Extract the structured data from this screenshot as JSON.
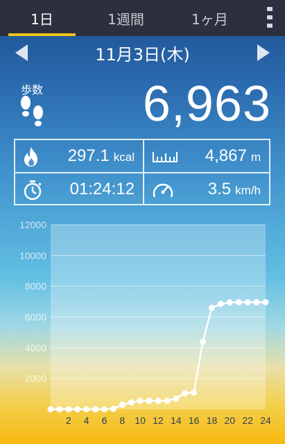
{
  "tabs": [
    {
      "label": "1日",
      "active": true
    },
    {
      "label": "1週間",
      "active": false
    },
    {
      "label": "1ヶ月",
      "active": false
    }
  ],
  "date": "11月3日(木)",
  "steps": {
    "label": "歩数",
    "value": "6,963"
  },
  "stats": {
    "calories": {
      "value": "297.1",
      "unit": "kcal",
      "icon": "flame-icon"
    },
    "distance": {
      "value": "4,867",
      "unit": "m",
      "icon": "ruler-icon"
    },
    "duration": {
      "value": "01:24:12",
      "icon": "stopwatch-icon"
    },
    "speed": {
      "value": "3.5",
      "unit": "km/h",
      "icon": "speedometer-icon"
    }
  },
  "chart_data": {
    "type": "line",
    "title": "",
    "xlabel": "",
    "ylabel": "",
    "ylim": [
      0,
      12000
    ],
    "yticks": [
      2000,
      4000,
      6000,
      8000,
      10000,
      12000
    ],
    "xticks": [
      2,
      4,
      6,
      8,
      10,
      12,
      14,
      16,
      18,
      20,
      22,
      24
    ],
    "grid": true,
    "series": [
      {
        "color": "#ffffff",
        "x": [
          0,
          1,
          2,
          3,
          4,
          5,
          6,
          7,
          8,
          9,
          10,
          11,
          12,
          13,
          14,
          15,
          16,
          17,
          18,
          19,
          20,
          21,
          22,
          23,
          24
        ],
        "y": [
          0,
          0,
          0,
          0,
          0,
          0,
          0,
          30,
          300,
          450,
          550,
          550,
          550,
          550,
          700,
          1050,
          1100,
          4400,
          6600,
          6850,
          6950,
          6960,
          6960,
          6963,
          6963
        ]
      }
    ]
  }
}
